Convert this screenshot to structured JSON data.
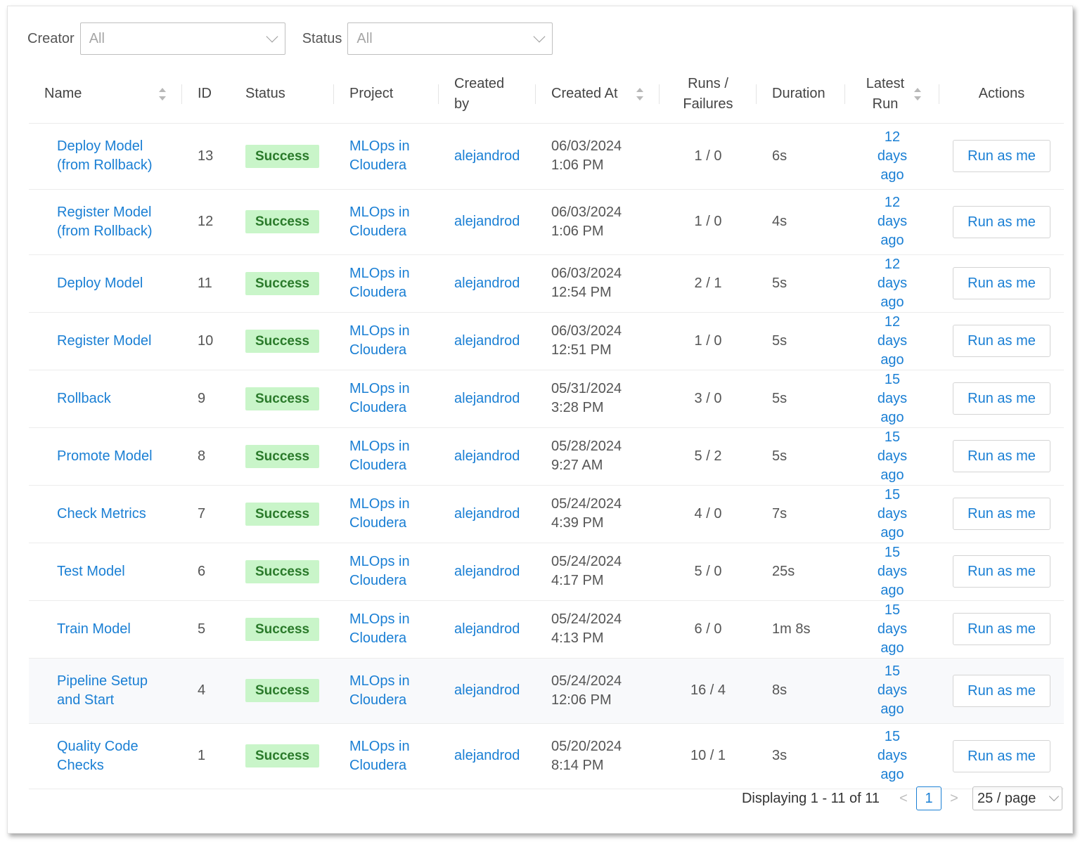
{
  "filters": {
    "creator_label": "Creator",
    "creator_value": "All",
    "status_label": "Status",
    "status_value": "All"
  },
  "columns": {
    "name": "Name",
    "id": "ID",
    "status": "Status",
    "project": "Project",
    "created_by": "Created by",
    "created_at": "Created At",
    "runs_failures": "Runs / Failures",
    "duration": "Duration",
    "latest_run": "Latest Run",
    "actions": "Actions"
  },
  "rows": [
    {
      "name": "Deploy Model (from Rollback)",
      "id": "13",
      "status": "Success",
      "project": "MLOps in Cloudera",
      "created_by": "alejandrod",
      "created_at": "06/03/2024 1:06 PM",
      "runs": "1 / 0",
      "duration": "6s",
      "latest": "12 days ago",
      "action": "Run as me"
    },
    {
      "name": "Register Model (from Rollback)",
      "id": "12",
      "status": "Success",
      "project": "MLOps in Cloudera",
      "created_by": "alejandrod",
      "created_at": "06/03/2024 1:06 PM",
      "runs": "1 / 0",
      "duration": "4s",
      "latest": "12 days ago",
      "action": "Run as me"
    },
    {
      "name": "Deploy Model",
      "id": "11",
      "status": "Success",
      "project": "MLOps in Cloudera",
      "created_by": "alejandrod",
      "created_at": "06/03/2024 12:54 PM",
      "runs": "2 / 1",
      "duration": "5s",
      "latest": "12 days ago",
      "action": "Run as me"
    },
    {
      "name": "Register Model",
      "id": "10",
      "status": "Success",
      "project": "MLOps in Cloudera",
      "created_by": "alejandrod",
      "created_at": "06/03/2024 12:51 PM",
      "runs": "1 / 0",
      "duration": "5s",
      "latest": "12 days ago",
      "action": "Run as me"
    },
    {
      "name": "Rollback",
      "id": "9",
      "status": "Success",
      "project": "MLOps in Cloudera",
      "created_by": "alejandrod",
      "created_at": "05/31/2024 3:28 PM",
      "runs": "3 / 0",
      "duration": "5s",
      "latest": "15 days ago",
      "action": "Run as me"
    },
    {
      "name": "Promote Model",
      "id": "8",
      "status": "Success",
      "project": "MLOps in Cloudera",
      "created_by": "alejandrod",
      "created_at": "05/28/2024 9:27 AM",
      "runs": "5 / 2",
      "duration": "5s",
      "latest": "15 days ago",
      "action": "Run as me"
    },
    {
      "name": "Check Metrics",
      "id": "7",
      "status": "Success",
      "project": "MLOps in Cloudera",
      "created_by": "alejandrod",
      "created_at": "05/24/2024 4:39 PM",
      "runs": "4 / 0",
      "duration": "7s",
      "latest": "15 days ago",
      "action": "Run as me"
    },
    {
      "name": "Test Model",
      "id": "6",
      "status": "Success",
      "project": "MLOps in Cloudera",
      "created_by": "alejandrod",
      "created_at": "05/24/2024 4:17 PM",
      "runs": "5 / 0",
      "duration": "25s",
      "latest": "15 days ago",
      "action": "Run as me"
    },
    {
      "name": "Train Model",
      "id": "5",
      "status": "Success",
      "project": "MLOps in Cloudera",
      "created_by": "alejandrod",
      "created_at": "05/24/2024 4:13 PM",
      "runs": "6 / 0",
      "duration": "1m 8s",
      "latest": "15 days ago",
      "action": "Run as me"
    },
    {
      "name": "Pipeline Setup and Start",
      "id": "4",
      "status": "Success",
      "project": "MLOps in Cloudera",
      "created_by": "alejandrod",
      "created_at": "05/24/2024 12:06 PM",
      "runs": "16 / 4",
      "duration": "8s",
      "latest": "15 days ago",
      "action": "Run as me"
    },
    {
      "name": "Quality Code Checks",
      "id": "1",
      "status": "Success",
      "project": "MLOps in Cloudera",
      "created_by": "alejandrod",
      "created_at": "05/20/2024 8:14 PM",
      "runs": "10 / 1",
      "duration": "3s",
      "latest": "15 days ago",
      "action": "Run as me"
    }
  ],
  "pagination": {
    "summary": "Displaying 1 - 11 of 11",
    "prev": "<",
    "current": "1",
    "next": ">",
    "page_size": "25 / page"
  },
  "colors": {
    "link": "#1a7fd4",
    "badge_bg": "#c9f5c9",
    "badge_text": "#2a7a2a"
  }
}
